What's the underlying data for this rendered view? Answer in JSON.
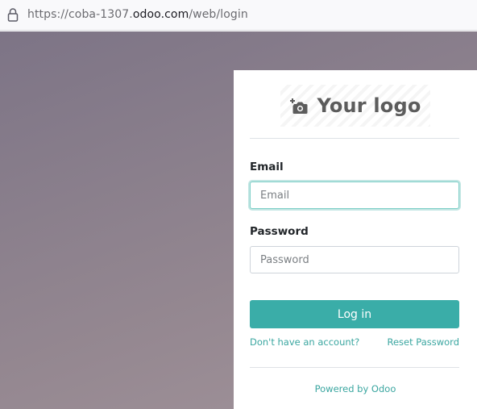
{
  "browser": {
    "url_prefix": "https://coba-1307.",
    "url_host": "odoo.com",
    "url_path": "/web/login",
    "lock_icon": "lock-icon"
  },
  "login": {
    "logo_text": "Your logo",
    "logo_icon": "camera-add-icon",
    "email_label": "Email",
    "email_placeholder": "Email",
    "email_value": "",
    "password_label": "Password",
    "password_placeholder": "Password",
    "password_value": "",
    "login_button": "Log in",
    "signup_link": "Don't have an account?",
    "reset_link": "Reset Password",
    "powered_by": "Powered by Odoo"
  },
  "colors": {
    "accent": "#3aada8",
    "link": "#3aa6a0",
    "background": "#8a7f8c"
  }
}
